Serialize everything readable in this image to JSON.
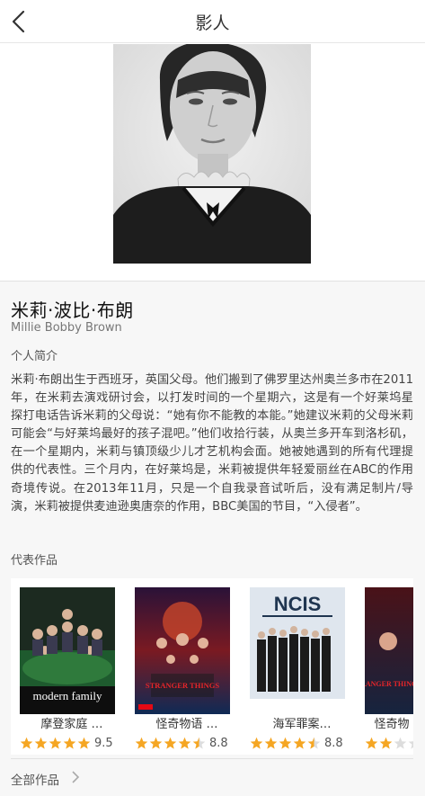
{
  "header": {
    "title": "影人"
  },
  "person": {
    "name_cn": "米莉·波比·布朗",
    "name_en": "Millie Bobby Brown"
  },
  "bio": {
    "section_title": "个人简介",
    "text": "米莉·布朗出生于西班牙，英国父母。他们搬到了佛罗里达州奥兰多市在2011年，在米莉去演戏研讨会，以打发时间的一个星期六，这是有一个好莱坞星探打电话告诉米莉的父母说：“她有你不能教的本能。”她建议米莉的父母米莉可能会“与好莱坞最好的孩子混吧。”他们收拾行装，从奥兰多开车到洛杉矶，在一个星期内，米莉与镇顶级少儿才艺机构会面。她被她遇到的所有代理提供的代表性。三个月内，在好莱坞是，米莉被提供年轻爱丽丝在ABC的作用奇境传说。在2013年11月，只是一个自我录音试听后，没有满足制片/导演，米莉被提供麦迪逊奥唐奈的作用，BBC美国的节目，“入侵者”。"
  },
  "works": {
    "section_title": "代表作品",
    "items": [
      {
        "title": "摩登家庭 …",
        "score": "9.5",
        "stars": 5,
        "poster_text": "modern family"
      },
      {
        "title": "怪奇物语 …",
        "score": "8.8",
        "stars": 4.5,
        "poster_text": "STRANGER THINGS"
      },
      {
        "title": "海军罪案…",
        "score": "8.8",
        "stars": 4.5,
        "poster_text": "NCIS"
      },
      {
        "title": "怪奇物",
        "score": "",
        "stars": 2,
        "poster_text": "STRANGER THINGS"
      }
    ],
    "all_label": "全部作品"
  },
  "colors": {
    "star": "#f5a623",
    "star_empty": "#dddddd"
  }
}
